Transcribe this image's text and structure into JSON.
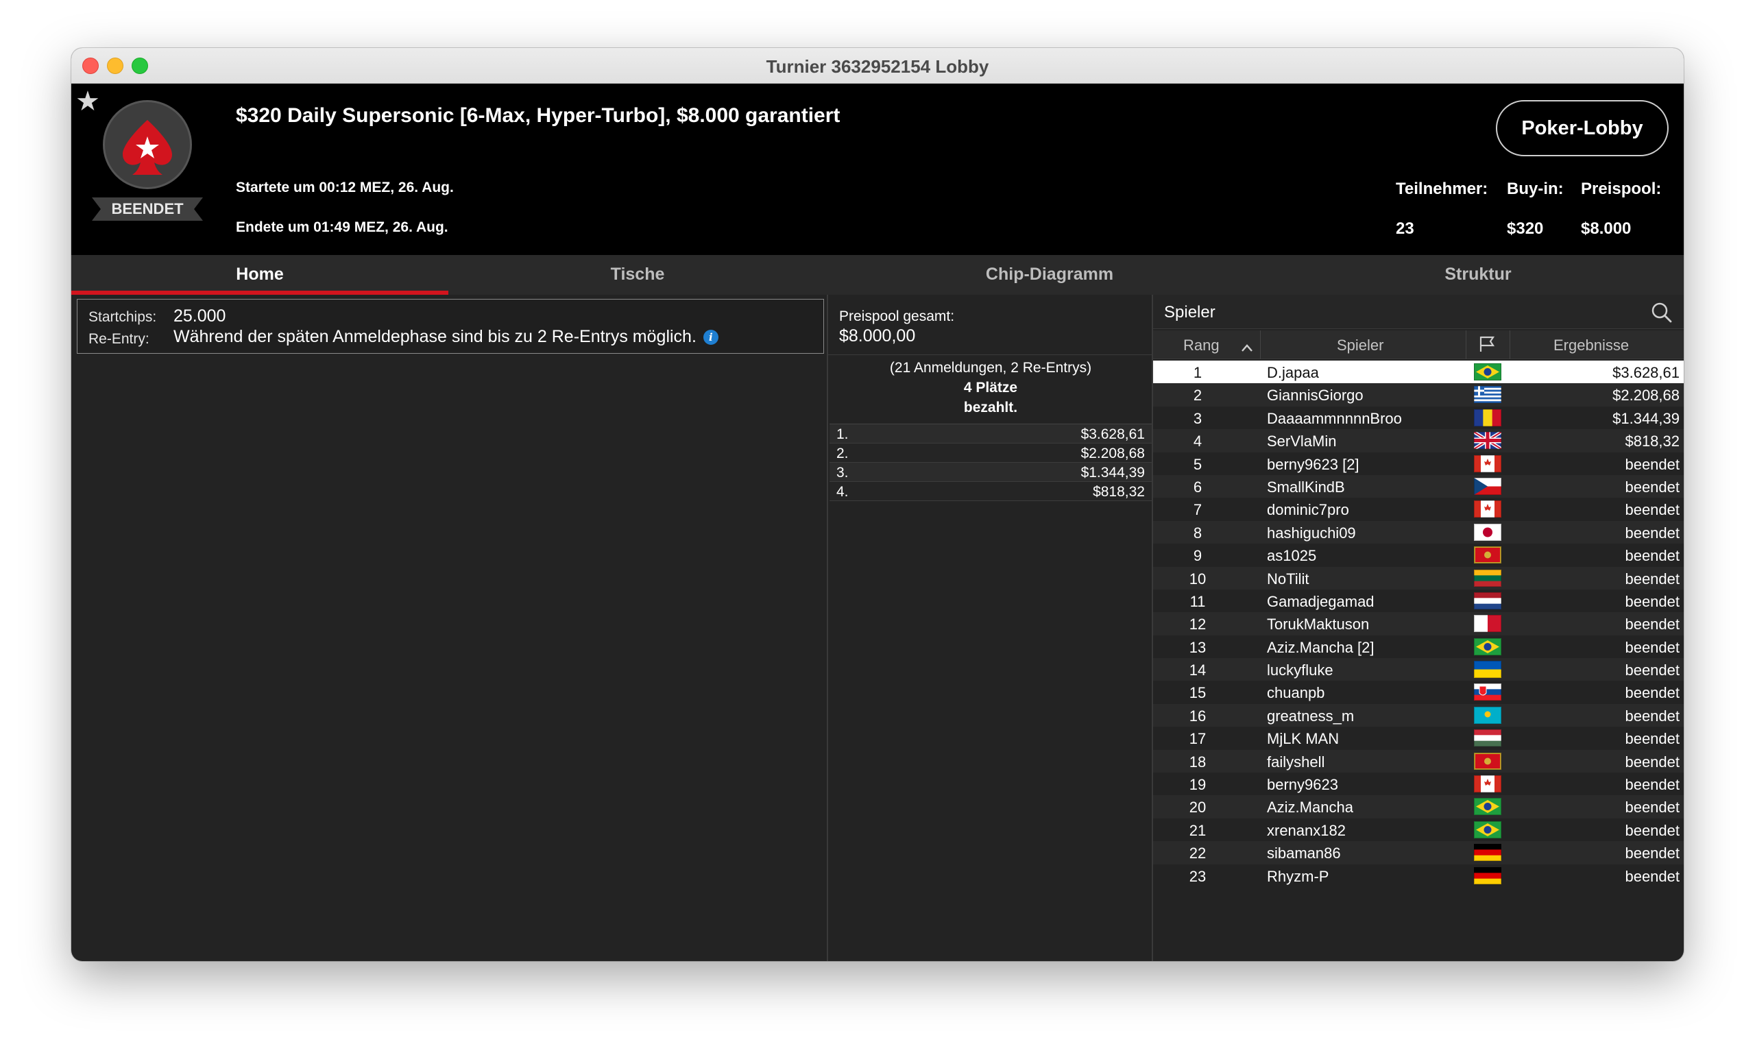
{
  "window": {
    "title": "Turnier 3632952154 Lobby"
  },
  "tournament": {
    "name": "$320 Daily Supersonic [6-Max, Hyper-Turbo], $8.000 garantiert",
    "status": "BEENDET",
    "started": "Startete um 00:12 MEZ, 26. Aug.",
    "ended": "Endete um 01:49 MEZ, 26. Aug.",
    "lobby_button": "Poker-Lobby",
    "stats": {
      "participants_label": "Teilnehmer:",
      "participants": "23",
      "buyin_label": "Buy-in:",
      "buyin": "$320",
      "prizepool_label": "Preispool:",
      "prizepool": "$8.000"
    },
    "brand_color": "#d2141e"
  },
  "tabs": [
    {
      "label": "Home",
      "active": true
    },
    {
      "label": "Tische",
      "active": false
    },
    {
      "label": "Chip-Diagramm",
      "active": false
    },
    {
      "label": "Struktur",
      "active": false
    }
  ],
  "info": {
    "startchips_label": "Startchips:",
    "startchips": "25.000",
    "reentry_label": "Re-Entry:",
    "reentry": "Während der späten Anmeldephase sind bis zu 2 Re-Entrys möglich.",
    "info_icon": "info-icon"
  },
  "prizes": {
    "total_label": "Preispool gesamt:",
    "total": "$8.000,00",
    "entries_note": "(21 Anmeldungen, 2 Re-Entrys)",
    "paid_places": "4 Plätze",
    "paid_word": "bezahlt.",
    "payouts": [
      {
        "place": "1.",
        "amount": "$3.628,61"
      },
      {
        "place": "2.",
        "amount": "$2.208,68"
      },
      {
        "place": "3.",
        "amount": "$1.344,39"
      },
      {
        "place": "4.",
        "amount": "$818,32"
      }
    ]
  },
  "players": {
    "title": "Spieler",
    "columns": {
      "rank": "Rang",
      "player": "Spieler",
      "result": "Ergebnisse"
    },
    "rows": [
      {
        "rank": "1",
        "name": "D.japaa",
        "flag": "brazil",
        "result": "$3.628,61"
      },
      {
        "rank": "2",
        "name": "GiannisGiorgo",
        "flag": "greece",
        "result": "$2.208,68"
      },
      {
        "rank": "3",
        "name": "DaaaammnnnnBroo",
        "flag": "romania",
        "result": "$1.344,39"
      },
      {
        "rank": "4",
        "name": "SerVlaMin",
        "flag": "uk",
        "result": "$818,32"
      },
      {
        "rank": "5",
        "name": "berny9623 [2]",
        "flag": "canada",
        "result": "beendet"
      },
      {
        "rank": "6",
        "name": "SmallKindB",
        "flag": "czech",
        "result": "beendet"
      },
      {
        "rank": "7",
        "name": "dominic7pro",
        "flag": "canada",
        "result": "beendet"
      },
      {
        "rank": "8",
        "name": "hashiguchi09",
        "flag": "japan",
        "result": "beendet"
      },
      {
        "rank": "9",
        "name": "as1025",
        "flag": "montenegro",
        "result": "beendet"
      },
      {
        "rank": "10",
        "name": "NoTilit",
        "flag": "lithuania",
        "result": "beendet"
      },
      {
        "rank": "11",
        "name": "Gamadjegamad",
        "flag": "netherlands",
        "result": "beendet"
      },
      {
        "rank": "12",
        "name": "TorukMaktuson",
        "flag": "malta",
        "result": "beendet"
      },
      {
        "rank": "13",
        "name": "Aziz.Mancha [2]",
        "flag": "brazil",
        "result": "beendet"
      },
      {
        "rank": "14",
        "name": "luckyfluke",
        "flag": "ukraine",
        "result": "beendet"
      },
      {
        "rank": "15",
        "name": "chuanpb",
        "flag": "slovakia",
        "result": "beendet"
      },
      {
        "rank": "16",
        "name": "greatness_m",
        "flag": "kazakhstan",
        "result": "beendet"
      },
      {
        "rank": "17",
        "name": "MjLK MAN",
        "flag": "hungary",
        "result": "beendet"
      },
      {
        "rank": "18",
        "name": "failyshell",
        "flag": "montenegro",
        "result": "beendet"
      },
      {
        "rank": "19",
        "name": "berny9623",
        "flag": "canada",
        "result": "beendet"
      },
      {
        "rank": "20",
        "name": "Aziz.Mancha",
        "flag": "brazil",
        "result": "beendet"
      },
      {
        "rank": "21",
        "name": "xrenanx182",
        "flag": "brazil",
        "result": "beendet"
      },
      {
        "rank": "22",
        "name": "sibaman86",
        "flag": "germany",
        "result": "beendet"
      },
      {
        "rank": "23",
        "name": "Rhyzm-P",
        "flag": "germany",
        "result": "beendet"
      }
    ]
  }
}
